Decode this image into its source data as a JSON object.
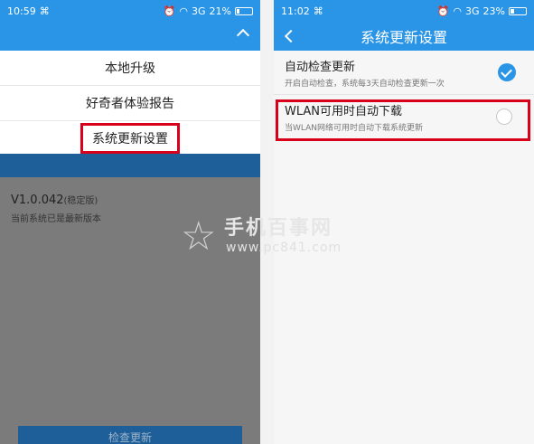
{
  "left_screen": {
    "status": {
      "time": "10:59",
      "network": "3G",
      "battery": "21%",
      "battery_level": 0.21
    },
    "menu": {
      "items": [
        {
          "label": "本地升级"
        },
        {
          "label": "好奇者体验报告"
        },
        {
          "label": "系统更新设置"
        }
      ]
    },
    "version": {
      "number": "V1.0.042",
      "tag": "(稳定版)",
      "status": "当前系统已是最新版本"
    },
    "check_button": "检查更新"
  },
  "right_screen": {
    "status": {
      "time": "11:02",
      "network": "3G",
      "battery": "23%",
      "battery_level": 0.23
    },
    "title": "系统更新设置",
    "settings": [
      {
        "title": "自动检查更新",
        "desc": "开启自动检查，系统每3天自动检查更新一次",
        "checked": true
      },
      {
        "title": "WLAN可用时自动下载",
        "desc": "当WLAN网络可用时自动下载系统更新",
        "checked": false
      }
    ]
  },
  "watermark": {
    "text": "手机百事网",
    "url": "www.pc841.com"
  },
  "colors": {
    "accent": "#2a95e6",
    "highlight": "#d9001b"
  }
}
